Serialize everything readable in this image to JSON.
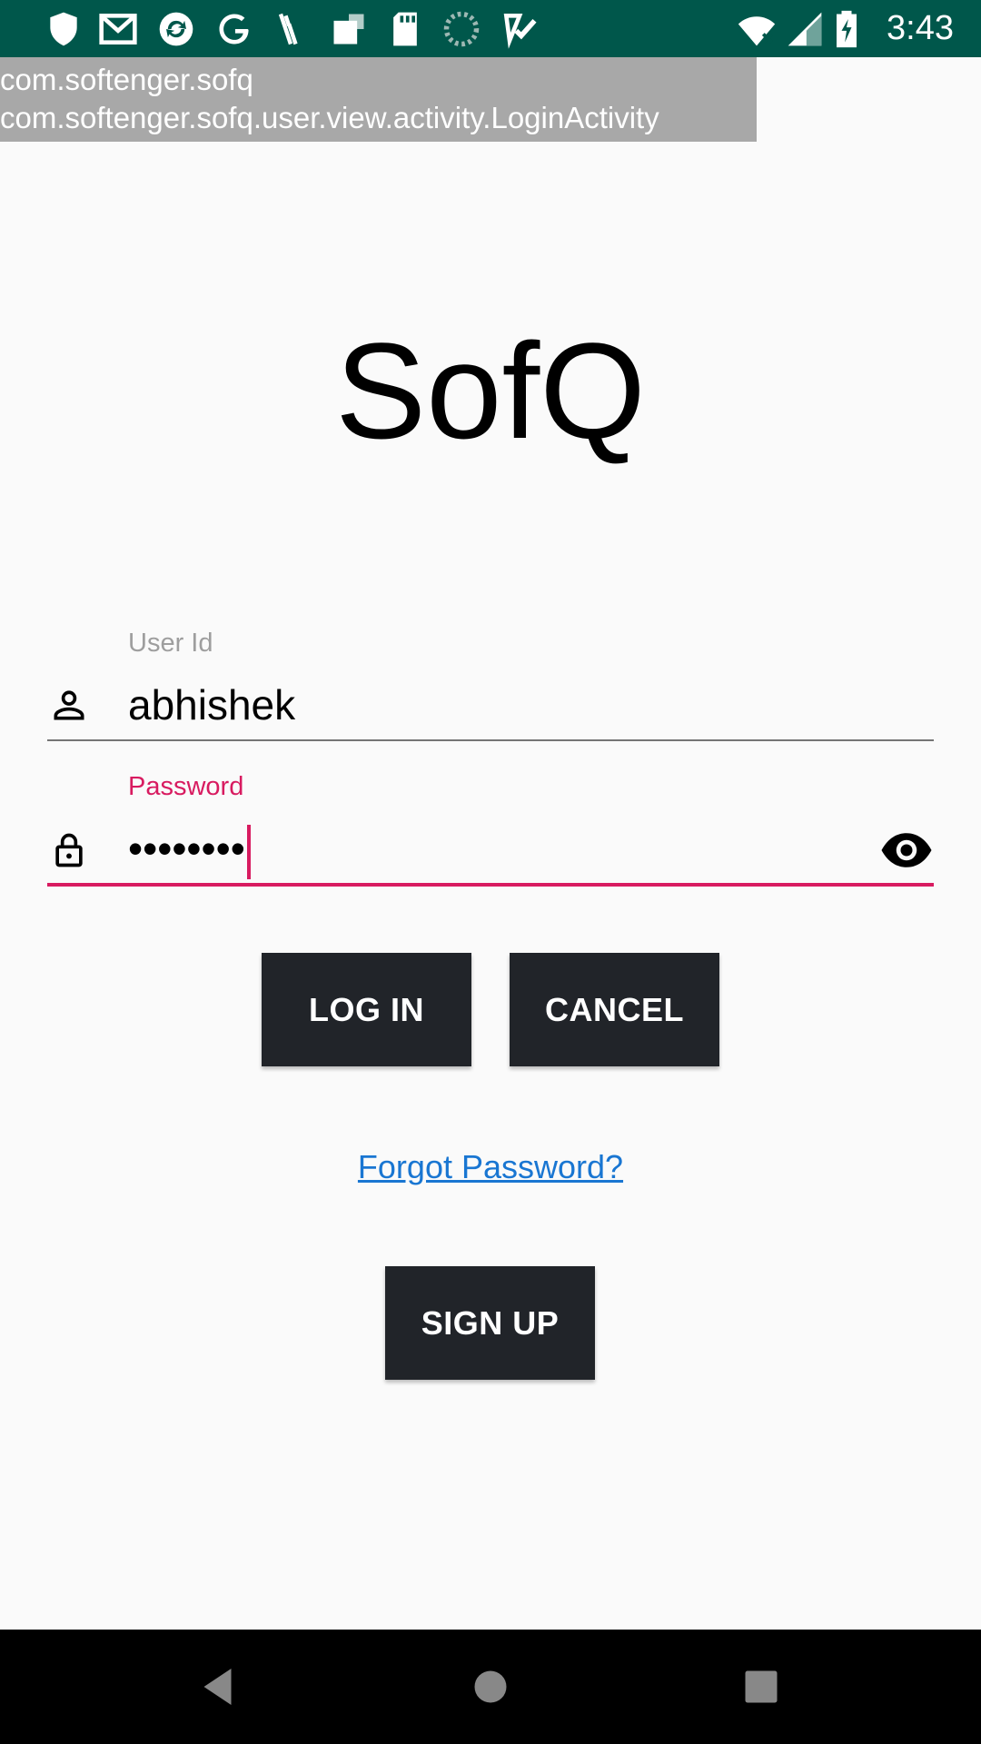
{
  "status_bar": {
    "time": "3:43",
    "background": "#00574b",
    "notification_icons": [
      "shield-icon",
      "gmail-icon",
      "sync-icon",
      "google-icon",
      "pen-icon",
      "square-icon",
      "sd-card-icon",
      "loading-icon",
      "checkmark-app-icon"
    ],
    "system_icons": [
      "wifi-icon",
      "cellular-signal-icon",
      "battery-charging-icon"
    ]
  },
  "debug_overlay": {
    "package": "com.softenger.sofq",
    "activity": "com.softenger.sofq.user.view.activity.LoginActivity"
  },
  "app": {
    "title": "SofQ"
  },
  "user_id": {
    "label": "User Id",
    "value": "abhishek",
    "icon": "person-icon"
  },
  "password": {
    "label": "Password",
    "value": "••••••••",
    "icon": "lock-icon",
    "toggle_icon": "eye-icon",
    "accent": "#d81b60"
  },
  "buttons": {
    "login": "LOG IN",
    "cancel": "CANCEL",
    "signup": "SIGN UP",
    "background": "#212429"
  },
  "forgot_password": "Forgot Password?",
  "nav_bar": {
    "icons": [
      "back-icon",
      "home-icon",
      "recents-icon"
    ]
  }
}
